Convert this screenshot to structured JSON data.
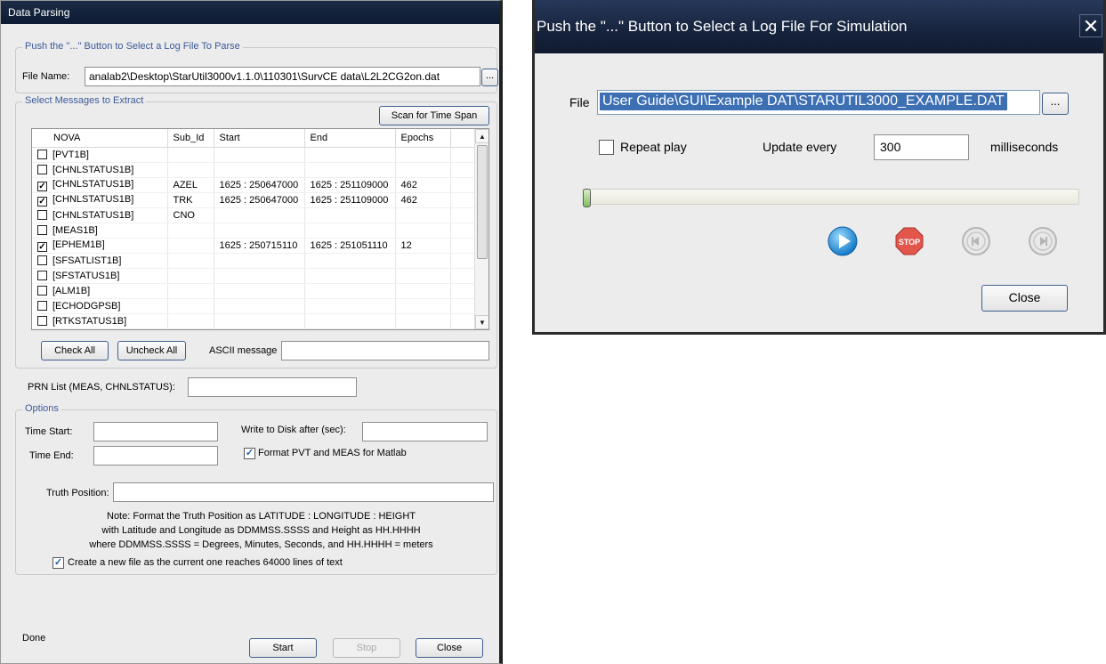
{
  "parsing": {
    "title": "Data Parsing",
    "file_group_label": "Push the \"...\" Button to Select a Log File To Parse",
    "file_name_label": "File Name:",
    "file_name_value": "analab2\\Desktop\\StarUtil3000v1.1.0\\110301\\SurvCE data\\L2L2CG2on.dat",
    "browse_label": "...",
    "messages_group_label": "Select Messages to Extract",
    "scan_button": "Scan for Time Span",
    "columns": [
      "NOVA",
      "Sub_Id",
      "Start",
      "End",
      "Epochs"
    ],
    "rows": [
      {
        "checked": false,
        "nova": "[PVT1B]",
        "sub_id": "",
        "start": "",
        "end": "",
        "epochs": ""
      },
      {
        "checked": false,
        "nova": "[CHNLSTATUS1B]",
        "sub_id": "",
        "start": "",
        "end": "",
        "epochs": ""
      },
      {
        "checked": true,
        "nova": "[CHNLSTATUS1B]",
        "sub_id": "AZEL",
        "start": "1625 : 250647000",
        "end": "1625 : 251109000",
        "epochs": "462"
      },
      {
        "checked": true,
        "nova": "[CHNLSTATUS1B]",
        "sub_id": "TRK",
        "start": "1625 : 250647000",
        "end": "1625 : 251109000",
        "epochs": "462"
      },
      {
        "checked": false,
        "nova": "[CHNLSTATUS1B]",
        "sub_id": "CNO",
        "start": "",
        "end": "",
        "epochs": ""
      },
      {
        "checked": false,
        "nova": "[MEAS1B]",
        "sub_id": "",
        "start": "",
        "end": "",
        "epochs": ""
      },
      {
        "checked": true,
        "nova": "[EPHEM1B]",
        "sub_id": "",
        "start": "1625 : 250715110",
        "end": "1625 : 251051110",
        "epochs": "12"
      },
      {
        "checked": false,
        "nova": "[SFSATLIST1B]",
        "sub_id": "",
        "start": "",
        "end": "",
        "epochs": ""
      },
      {
        "checked": false,
        "nova": "[SFSTATUS1B]",
        "sub_id": "",
        "start": "",
        "end": "",
        "epochs": ""
      },
      {
        "checked": false,
        "nova": "[ALM1B]",
        "sub_id": "",
        "start": "",
        "end": "",
        "epochs": ""
      },
      {
        "checked": false,
        "nova": "[ECHODGPSB]",
        "sub_id": "",
        "start": "",
        "end": "",
        "epochs": ""
      },
      {
        "checked": false,
        "nova": "[RTKSTATUS1B]",
        "sub_id": "",
        "start": "",
        "end": "",
        "epochs": ""
      }
    ],
    "check_all": "Check All",
    "uncheck_all": "Uncheck All",
    "ascii_label": "ASCII message",
    "ascii_value": "",
    "prn_label": "PRN List (MEAS, CHNLSTATUS):",
    "prn_value": "",
    "options_label": "Options",
    "time_start_label": "Time Start:",
    "time_start_value": "",
    "time_end_label": "Time End:",
    "time_end_value": "",
    "write_disk_label": "Write to Disk after  (sec):",
    "write_disk_value": "",
    "format_matlab_label": "Format PVT and MEAS for Matlab",
    "format_matlab_checked": true,
    "truth_label": "Truth Position:",
    "truth_value": "",
    "note_lines": [
      "Note: Format the Truth Position as LATITUDE : LONGITUDE : HEIGHT",
      "with Latitude and Longitude as DDMMSS.SSSS and Height as HH.HHHH",
      "where DDMMSS.SSSS = Degrees, Minutes, Seconds, and HH.HHHH = meters"
    ],
    "new_file_label": "Create a new file as the current one reaches 64000 lines of text",
    "new_file_checked": true,
    "status": "Done",
    "start_button": "Start",
    "stop_button": "Stop",
    "close_button": "Close"
  },
  "simulation": {
    "title": "Push the \"...\" Button to Select a Log File For Simulation",
    "close_glyph": "✕",
    "file_label": "File",
    "file_value": "User Guide\\GUI\\Example DAT\\STARUTIL3000_EXAMPLE.DAT",
    "browse_label": "...",
    "repeat_label": "Repeat play",
    "repeat_checked": false,
    "update_label": "Update every",
    "update_value": "300",
    "ms_label": "milliseconds",
    "progress": 0,
    "stop_label": "STOP",
    "close_button": "Close"
  }
}
